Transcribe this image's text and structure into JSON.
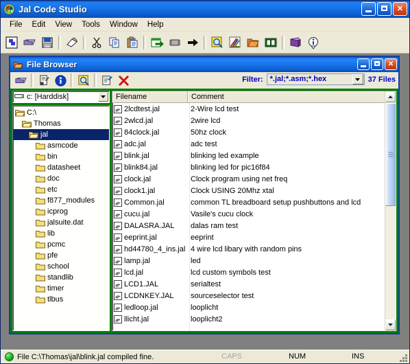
{
  "app": {
    "title": "Jal Code Studio",
    "icon": "app-logo-icon"
  },
  "menu": {
    "items": [
      {
        "label": "File"
      },
      {
        "label": "Edit"
      },
      {
        "label": "View"
      },
      {
        "label": "Tools"
      },
      {
        "label": "Window"
      },
      {
        "label": "Help"
      }
    ]
  },
  "toolbar": {
    "buttons": [
      {
        "name": "new-file-icon",
        "title": "New"
      },
      {
        "name": "open-file-icon",
        "title": "Open"
      },
      {
        "name": "save-file-icon",
        "title": "Save"
      },
      {
        "name": "print-icon",
        "title": "Print"
      },
      {
        "name": "cut-icon",
        "title": "Cut"
      },
      {
        "name": "copy-icon",
        "title": "Copy"
      },
      {
        "name": "paste-icon",
        "title": "Paste"
      },
      {
        "name": "compile-icon",
        "title": "Compile"
      },
      {
        "name": "chip-icon",
        "title": "Program chip"
      },
      {
        "name": "run-arrow-icon",
        "title": "Run"
      },
      {
        "name": "find-icon",
        "title": "Find"
      },
      {
        "name": "tools-icon",
        "title": "Tools"
      },
      {
        "name": "file-browser-icon",
        "title": "File Browser"
      },
      {
        "name": "book-open-icon",
        "title": "Reference"
      },
      {
        "name": "library-icon",
        "title": "Library"
      },
      {
        "name": "about-info-icon",
        "title": "About"
      }
    ]
  },
  "child_window": {
    "title": "File Browser",
    "icon": "folder-window-icon",
    "toolbar": {
      "buttons": [
        {
          "name": "open-folder-icon",
          "title": "Open"
        },
        {
          "name": "file-properties-icon",
          "title": "File info"
        },
        {
          "name": "info-icon",
          "title": "Info"
        },
        {
          "name": "preview-icon",
          "title": "Preview"
        },
        {
          "name": "edit-properties-icon",
          "title": "Properties"
        },
        {
          "name": "delete-icon",
          "title": "Delete"
        }
      ]
    },
    "filter": {
      "label": "Filter:",
      "value": "*.jal;*.asm;*.hex",
      "file_count": "37 Files"
    },
    "drive": {
      "value": "c: [Harddisk]",
      "icon": "harddisk-icon"
    },
    "tree": {
      "nodes": [
        {
          "label": "C:\\",
          "indent": 0,
          "selected": false,
          "open": true
        },
        {
          "label": "Thomas",
          "indent": 1,
          "selected": false,
          "open": true
        },
        {
          "label": "jal",
          "indent": 2,
          "selected": true,
          "open": true
        },
        {
          "label": "asmcode",
          "indent": 3,
          "selected": false,
          "open": false
        },
        {
          "label": "bin",
          "indent": 3,
          "selected": false,
          "open": false
        },
        {
          "label": "datasheet",
          "indent": 3,
          "selected": false,
          "open": false
        },
        {
          "label": "doc",
          "indent": 3,
          "selected": false,
          "open": false
        },
        {
          "label": "etc",
          "indent": 3,
          "selected": false,
          "open": false
        },
        {
          "label": "f877_modules",
          "indent": 3,
          "selected": false,
          "open": false
        },
        {
          "label": "icprog",
          "indent": 3,
          "selected": false,
          "open": false
        },
        {
          "label": "jalsuite.dat",
          "indent": 3,
          "selected": false,
          "open": false
        },
        {
          "label": "lib",
          "indent": 3,
          "selected": false,
          "open": false
        },
        {
          "label": "pcmc",
          "indent": 3,
          "selected": false,
          "open": false
        },
        {
          "label": "pfe",
          "indent": 3,
          "selected": false,
          "open": false
        },
        {
          "label": "school",
          "indent": 3,
          "selected": false,
          "open": false
        },
        {
          "label": "standlib",
          "indent": 3,
          "selected": false,
          "open": false
        },
        {
          "label": "timer",
          "indent": 3,
          "selected": false,
          "open": false
        },
        {
          "label": "tlbus",
          "indent": 3,
          "selected": false,
          "open": false
        }
      ]
    },
    "filelist": {
      "columns": [
        "Filename",
        "Comment"
      ],
      "rows": [
        {
          "filename": "2lcdtest.jal",
          "comment": "2-Wire lcd test"
        },
        {
          "filename": "2wlcd.jal",
          "comment": "2wire lcd"
        },
        {
          "filename": "84clock.jal",
          "comment": "50hz clock"
        },
        {
          "filename": "adc.jal",
          "comment": "adc test"
        },
        {
          "filename": "blink.jal",
          "comment": "blinking led example"
        },
        {
          "filename": "blink84.jal",
          "comment": "blinking led for pic16f84"
        },
        {
          "filename": "clock.jal",
          "comment": "Clock program using net freq"
        },
        {
          "filename": "clock1.jal",
          "comment": "Clock USING 20Mhz xtal"
        },
        {
          "filename": "Common.jal",
          "comment": "common TL breadboard setup pushbuttons and lcd"
        },
        {
          "filename": "cucu.jal",
          "comment": "Vasile's cucu clock"
        },
        {
          "filename": "DALASRA.JAL",
          "comment": "dalas ram test"
        },
        {
          "filename": "eeprint.jal",
          "comment": "eeprint"
        },
        {
          "filename": "hd44780_4_ins.jal",
          "comment": "4 wire lcd libary with random pins"
        },
        {
          "filename": "lamp.jal",
          "comment": "led"
        },
        {
          "filename": "lcd.jal",
          "comment": "lcd custom symbols test"
        },
        {
          "filename": "LCD1.JAL",
          "comment": "serialtest"
        },
        {
          "filename": "LCDNKEY.JAL",
          "comment": "sourceselector test"
        },
        {
          "filename": "ledloop.jal",
          "comment": "looplicht"
        },
        {
          "filename": "llicht.jal",
          "comment": "looplicht2"
        }
      ]
    }
  },
  "statusbar": {
    "message": "File C:\\Thomas\\jal\\blink.jal compiled fine.",
    "caps": "CAPS",
    "num": "NUM",
    "ins": "INS",
    "led_color": "#16b016"
  },
  "colors": {
    "titlebar_blue": "#1573ea",
    "panel_green": "#008000",
    "child_border": "#1040a0",
    "face": "#ece9d8",
    "selection": "#0a246a",
    "filter_text": "#0000c0"
  }
}
